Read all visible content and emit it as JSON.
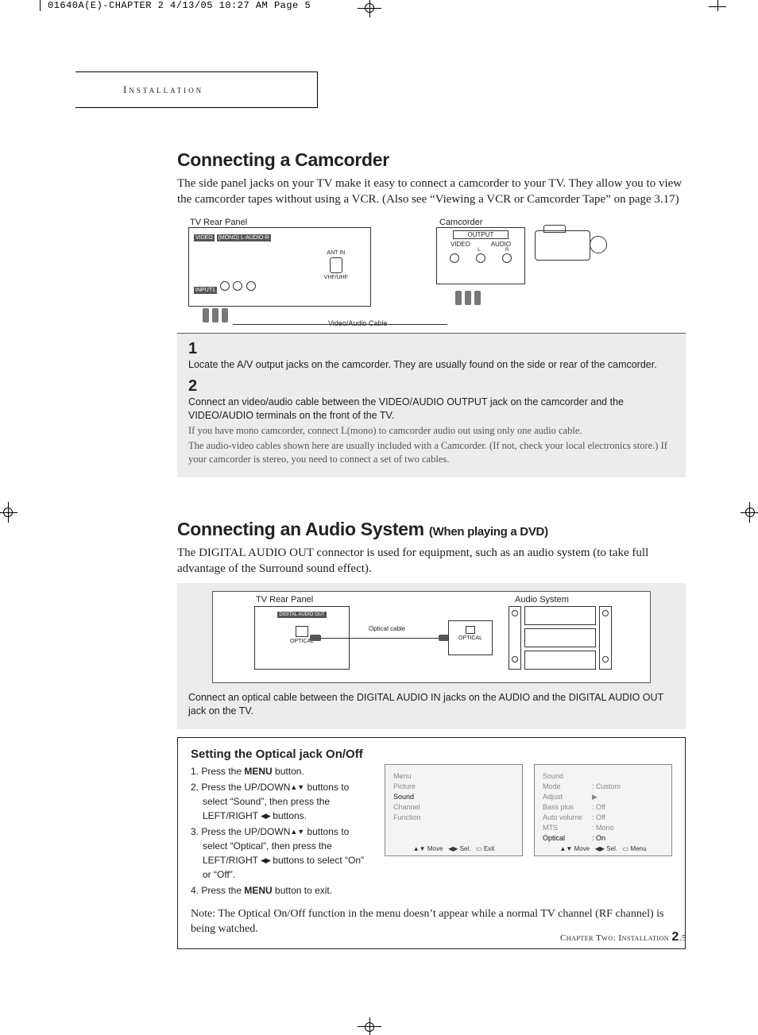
{
  "slug": "01640A(E)-CHAPTER 2  4/13/05  10:27 AM  Page 5",
  "chapter_tab": "Installation",
  "section1": {
    "title": "Connecting a Camcorder",
    "intro": "The side panel jacks on your TV make it easy to connect a camcorder to your TV. They allow you to view the camcorder tapes without using a VCR. (Also see “Viewing a VCR or Camcorder Tape” on page 3.17)",
    "diagram": {
      "tv_label": "TV Rear Panel",
      "cam_label": "Camcorder",
      "output": "OUTPUT",
      "video": "VIDEO",
      "audio": "AUDIO",
      "l": "L",
      "r": "R",
      "cable": "Video/Audio Cable",
      "input1": "INPUT1",
      "mono": "(MONO) L-AUDIO-R",
      "video2": "VIDEO",
      "spdif_ant": "ANT IN",
      "spdif_lbl": "VHF/UHF"
    },
    "steps": [
      {
        "n": "1",
        "text": "Locate the A/V output jacks on the camcorder. They are usually found on the side or rear of the camcorder."
      },
      {
        "n": "2",
        "text": "Connect an video/audio cable between the VIDEO/AUDIO OUTPUT jack on the camcorder and the VIDEO/AUDIO terminals on the front of the TV.",
        "sub1": "If you have mono camcorder, connect L(mono) to camcorder audio out using only one audio cable.",
        "sub2": "The audio-video cables shown here are usually included with a Camcorder. (If not, check your local electronics store.) If your camcorder is stereo, you need to connect a set of two cables."
      }
    ]
  },
  "section2": {
    "title": "Connecting an Audio System",
    "subtitle": "(When playing a DVD)",
    "intro": "The DIGITAL AUDIO OUT connector is used for equipment, such as an audio system (to take full advantage of the Surround sound effect).",
    "diagram": {
      "tv_label": "TV Rear Panel",
      "sys_label": "Audio System",
      "digital_out": "DIGITAL AUDIO OUT",
      "optical": "OPTICAL",
      "optical2": "OPTICAL",
      "cable": "Optical cable"
    },
    "step": "Connect an optical cable between the DIGITAL AUDIO IN jacks on the AUDIO and the DIGITAL AUDIO OUT jack on the TV."
  },
  "optical_box": {
    "title": "Setting the Optical jack On/Off",
    "steps": {
      "s1a": "1.  Press the ",
      "s1b": "MENU",
      "s1c": " button.",
      "s2a": "2.  Press the UP/DOWN",
      "s2b": " buttons to select “Sound”, then press the LEFT/RIGHT ",
      "s2c": " buttons.",
      "s3a": "3.  Press the UP/DOWN",
      "s3b": " buttons to select “Optical”, then press the LEFT/RIGHT ",
      "s3c": " buttons to select “On” or “Off”.",
      "s4a": "4.  Press the ",
      "s4b": "MENU",
      "s4c": " button to exit."
    },
    "osd1": {
      "title": "Menu",
      "items": [
        "Picture",
        "Sound",
        "Channel",
        "Function"
      ],
      "sel_index": 1,
      "footer_move": "Move",
      "footer_sel": "Sel.",
      "footer_exit": "Exit"
    },
    "osd2": {
      "title": "Sound",
      "rows": [
        {
          "k": "Mode",
          "v": ": Custom"
        },
        {
          "k": "Adjust",
          "v": "▶"
        },
        {
          "k": "Bass plus",
          "v": ": Off"
        },
        {
          "k": "Auto volume",
          "v": ": Off"
        },
        {
          "k": "MTS",
          "v": ": Mono"
        },
        {
          "k": "Optical",
          "v": ": On"
        }
      ],
      "sel_index": 5,
      "footer_move": "Move",
      "footer_sel": "Sel.",
      "footer_menu": "Menu"
    },
    "note": "Note: The Optical On/Off function in the menu doesn’t appear while a normal TV channel (RF channel) is being watched."
  },
  "footer": {
    "chapter": "Chapter Two: Installation ",
    "page": "2",
    "suffix": ".5"
  }
}
